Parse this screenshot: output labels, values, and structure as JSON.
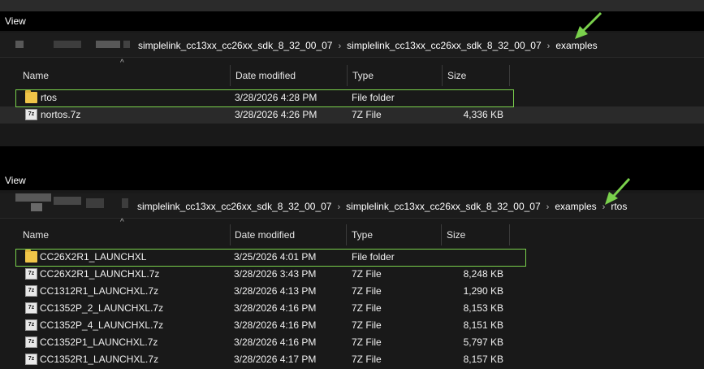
{
  "panes": [
    {
      "menu_label": "View",
      "breadcrumbs": [
        "simplelink_cc13xx_cc26xx_sdk_8_32_00_07",
        "simplelink_cc13xx_cc26xx_sdk_8_32_00_07",
        "examples"
      ],
      "columns": {
        "name": "Name",
        "date": "Date modified",
        "type": "Type",
        "size": "Size"
      },
      "sort_glyph": "^",
      "files": [
        {
          "name": "rtos",
          "date": "3/28/2026 4:28 PM",
          "type": "File folder",
          "size": "",
          "icon": "folder-icon"
        },
        {
          "name": "nortos.7z",
          "date": "3/28/2026 4:26 PM",
          "type": "7Z File",
          "size": "4,336 KB",
          "icon": "archive-file-icon"
        }
      ]
    },
    {
      "menu_label": "View",
      "breadcrumbs": [
        "simplelink_cc13xx_cc26xx_sdk_8_32_00_07",
        "simplelink_cc13xx_cc26xx_sdk_8_32_00_07",
        "examples",
        "rtos"
      ],
      "columns": {
        "name": "Name",
        "date": "Date modified",
        "type": "Type",
        "size": "Size"
      },
      "sort_glyph": "^",
      "files": [
        {
          "name": "CC26X2R1_LAUNCHXL",
          "date": "3/25/2026 4:01 PM",
          "type": "File folder",
          "size": "",
          "icon": "folder-icon"
        },
        {
          "name": "CC26X2R1_LAUNCHXL.7z",
          "date": "3/28/2026 3:43 PM",
          "type": "7Z File",
          "size": "8,248 KB",
          "icon": "archive-file-icon"
        },
        {
          "name": "CC1312R1_LAUNCHXL.7z",
          "date": "3/28/2026 4:13 PM",
          "type": "7Z File",
          "size": "1,290 KB",
          "icon": "archive-file-icon"
        },
        {
          "name": "CC1352P_2_LAUNCHXL.7z",
          "date": "3/28/2026 4:16 PM",
          "type": "7Z File",
          "size": "8,153 KB",
          "icon": "archive-file-icon"
        },
        {
          "name": "CC1352P_4_LAUNCHXL.7z",
          "date": "3/28/2026 4:16 PM",
          "type": "7Z File",
          "size": "8,151 KB",
          "icon": "archive-file-icon"
        },
        {
          "name": "CC1352P1_LAUNCHXL.7z",
          "date": "3/28/2026 4:16 PM",
          "type": "7Z File",
          "size": "5,797 KB",
          "icon": "archive-file-icon"
        },
        {
          "name": "CC1352R1_LAUNCHXL.7z",
          "date": "3/28/2026 4:17 PM",
          "type": "7Z File",
          "size": "8,157 KB",
          "icon": "archive-file-icon"
        }
      ]
    }
  ],
  "icon_glyphs": {
    "archive": "7z"
  },
  "colors": {
    "highlight": "#7ad14c",
    "arrow": "#7ad14c",
    "folder": "#f0c548",
    "background": "#191919"
  }
}
